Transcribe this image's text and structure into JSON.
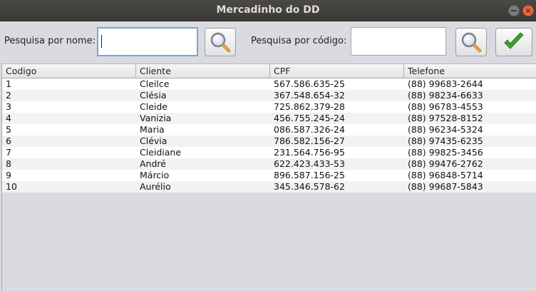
{
  "window": {
    "title": "Mercadinho do DD"
  },
  "search": {
    "name_label": "Pesquisa por nome:",
    "name_value": "",
    "code_label": "Pesquisa por código:",
    "code_value": ""
  },
  "icons": {
    "search_name": "magnifier-icon",
    "search_code": "magnifier-icon",
    "confirm": "checkmark-icon",
    "accent_check": "#3aa12a"
  },
  "table": {
    "columns": [
      "Codigo",
      "Cliente",
      "CPF",
      "Telefone"
    ],
    "rows": [
      [
        "1",
        "Cleilce",
        "567.586.635-25",
        "(88) 99683-2644"
      ],
      [
        "2",
        "Clésia",
        "367.548.654-32",
        "(88) 98234-6633"
      ],
      [
        "3",
        "Cleide",
        "725.862.379-28",
        "(88) 96783-4553"
      ],
      [
        "4",
        "Vanizia",
        "456.755.245-24",
        "(88) 97528-8152"
      ],
      [
        "5",
        "Maria",
        "086.587.326-24",
        "(88) 96234-5324"
      ],
      [
        "6",
        "Clévia",
        "786.582.156-27",
        "(88) 97435-6235"
      ],
      [
        "7",
        "Cleidiane",
        "231.564.756-95",
        "(88) 99825-3456"
      ],
      [
        "8",
        "André",
        "622.423.433-53",
        "(88) 99476-2762"
      ],
      [
        "9",
        "Márcio",
        "896.587.156-25",
        "(88) 96848-5714"
      ],
      [
        "10",
        "Aurélio",
        "345.346.578-62",
        "(88) 99687-5843"
      ]
    ]
  }
}
